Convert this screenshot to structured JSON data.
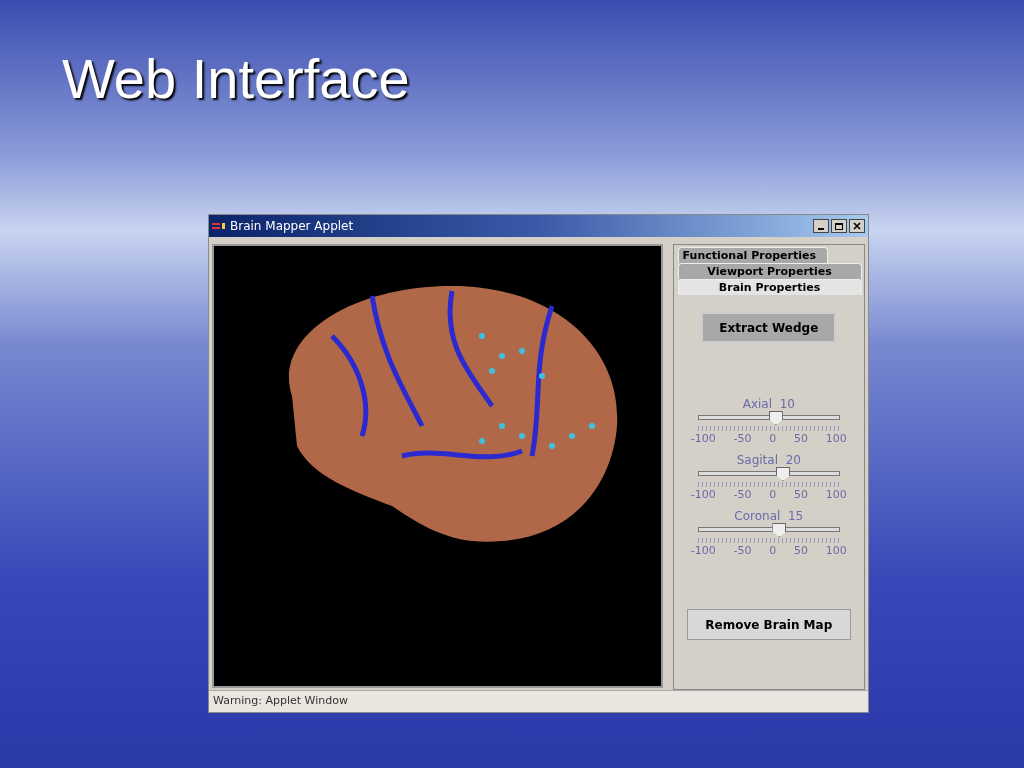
{
  "slide": {
    "title": "Web Interface"
  },
  "window": {
    "title": "Brain Mapper Applet",
    "status": "Warning: Applet Window"
  },
  "tabs": [
    {
      "label": "Functional Properties",
      "selected": false
    },
    {
      "label": "Viewport Properties",
      "selected": false
    },
    {
      "label": "Brain Properties",
      "selected": true
    }
  ],
  "buttons": {
    "extract": "Extract Wedge",
    "remove": "Remove Brain Map"
  },
  "sliders": [
    {
      "label": "Axial  10",
      "level": 0.55,
      "ticks": [
        "-100",
        "-50",
        "0",
        "50",
        "100"
      ]
    },
    {
      "label": "Sagital  20",
      "level": 0.6,
      "ticks": [
        "-100",
        "-50",
        "0",
        "50",
        "100"
      ]
    },
    {
      "label": "Coronal  15",
      "level": 0.575,
      "ticks": [
        "-100",
        "-50",
        "0",
        "50",
        "100"
      ]
    }
  ]
}
